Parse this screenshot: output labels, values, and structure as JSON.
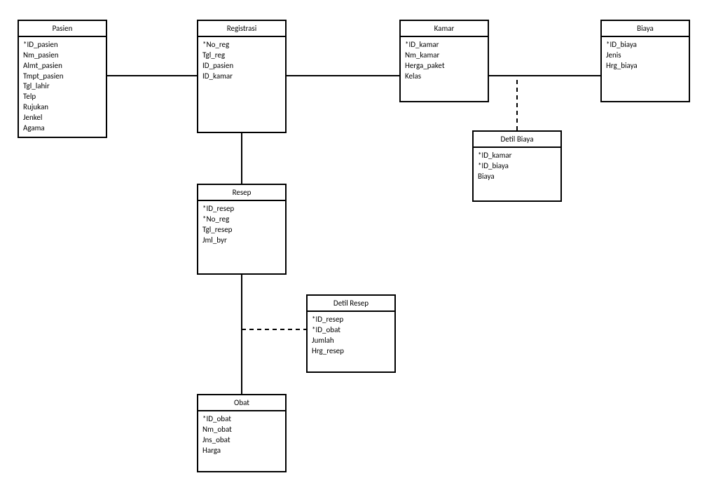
{
  "entities": {
    "pasien": {
      "title": "Pasien",
      "attrs": [
        "*ID_pasien",
        "Nm_pasien",
        "Almt_pasien",
        "Tmpt_pasien",
        "Tgl_lahir",
        "Telp",
        "Rujukan",
        "Jenkel",
        "Agama"
      ]
    },
    "registrasi": {
      "title": "Registrasi",
      "attrs": [
        "*No_reg",
        "Tgl_reg",
        "ID_pasien",
        "ID_kamar"
      ]
    },
    "kamar": {
      "title": "Kamar",
      "attrs": [
        "*ID_kamar",
        "Nm_kamar",
        "Herga_paket",
        "Kelas"
      ]
    },
    "biaya": {
      "title": "Biaya",
      "attrs": [
        "*ID_biaya",
        "Jenis",
        "Hrg_biaya"
      ]
    },
    "detilbiaya": {
      "title": "Detil Biaya",
      "attrs": [
        "*ID_kamar",
        "*ID_biaya",
        "Biaya"
      ]
    },
    "resep": {
      "title": "Resep",
      "attrs": [
        "*ID_resep",
        "*No_reg",
        "Tgl_resep",
        "Jml_byr"
      ]
    },
    "detilresep": {
      "title": "Detil Resep",
      "attrs": [
        "*ID_resep",
        "*ID_obat",
        "Jumlah",
        "Hrg_resep"
      ]
    },
    "obat": {
      "title": "Obat",
      "attrs": [
        "*ID_obat",
        "Nm_obat",
        "Jns_obat",
        "Harga"
      ]
    }
  }
}
